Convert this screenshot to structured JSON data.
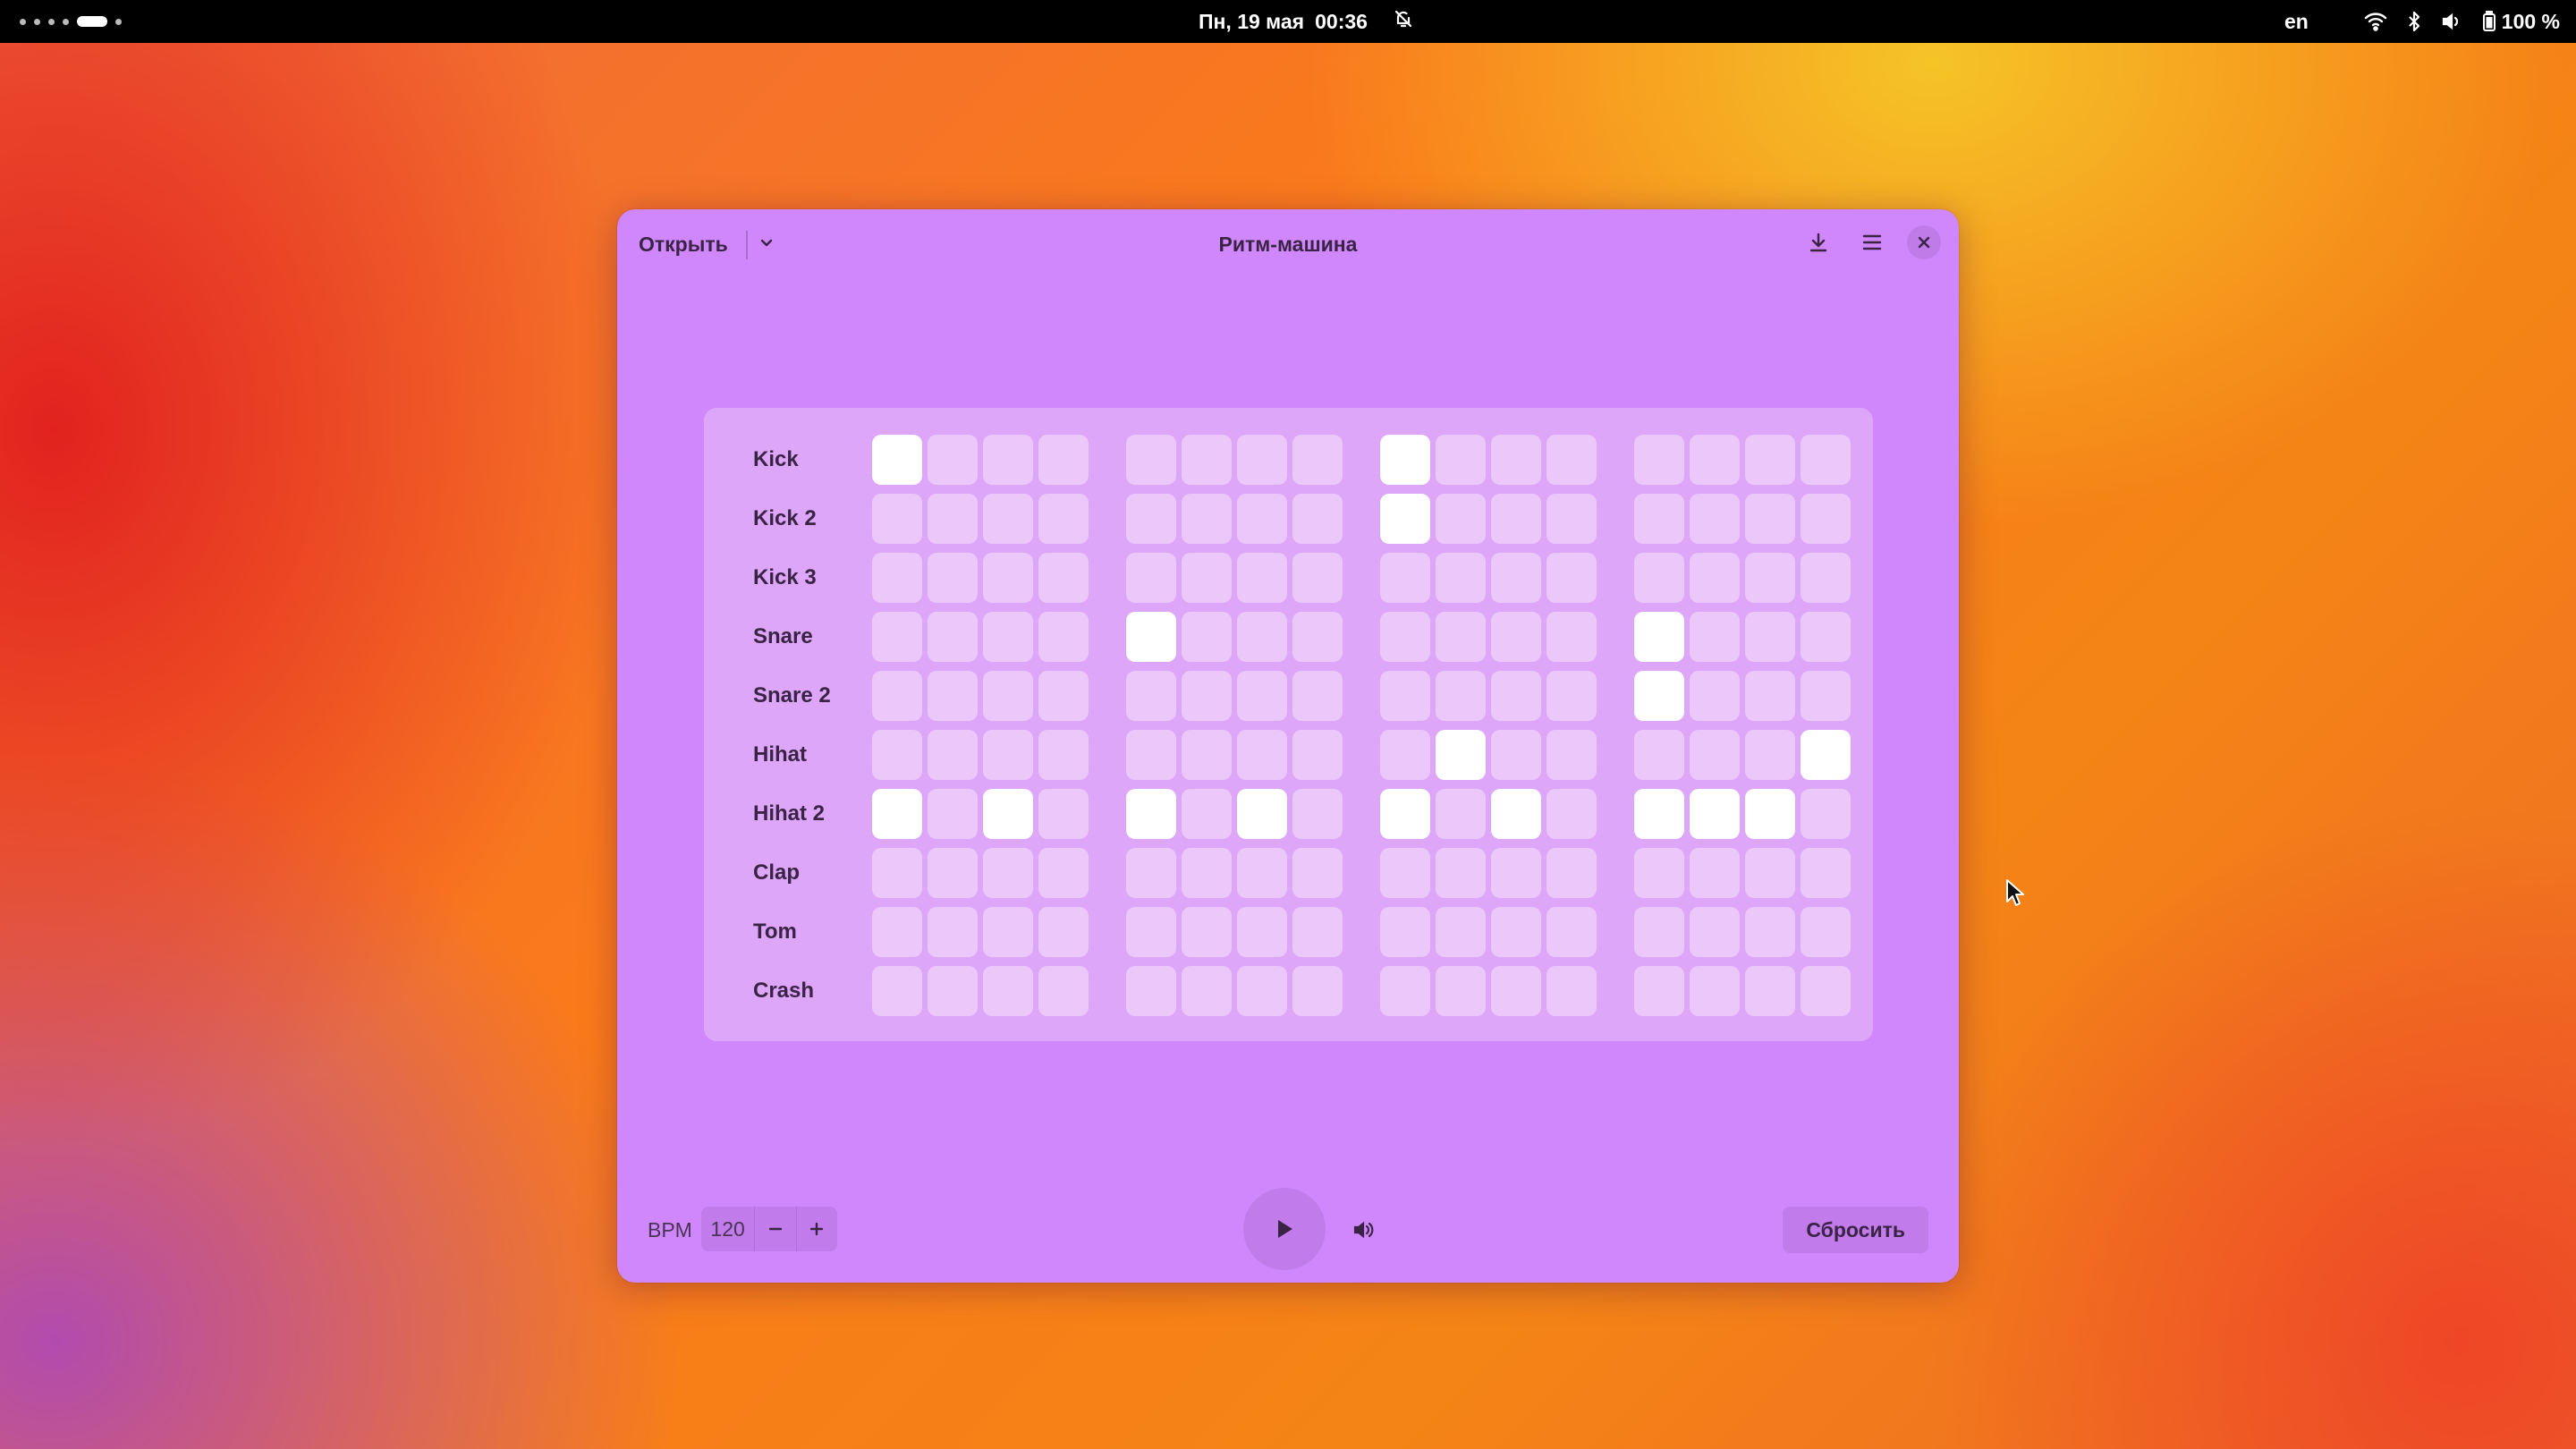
{
  "topbar": {
    "date": "Пн, 19 мая",
    "time": "00:36",
    "language": "en",
    "battery": "100 %",
    "icons": [
      "workspaces-indicator",
      "bell-off-icon",
      "wifi-icon",
      "bluetooth-icon",
      "volume-icon",
      "battery-icon"
    ]
  },
  "window": {
    "title": "Ритм-машина",
    "open_label": "Открыть",
    "header_icons": [
      "chevron-down-icon",
      "download-icon",
      "menu-icon",
      "close-icon"
    ]
  },
  "tracks": [
    {
      "name": "Kick",
      "steps": [
        1,
        0,
        0,
        0,
        0,
        0,
        0,
        0,
        1,
        0,
        0,
        0,
        0,
        0,
        0,
        0
      ]
    },
    {
      "name": "Kick 2",
      "steps": [
        0,
        0,
        0,
        0,
        0,
        0,
        0,
        0,
        1,
        0,
        0,
        0,
        0,
        0,
        0,
        0
      ]
    },
    {
      "name": "Kick 3",
      "steps": [
        0,
        0,
        0,
        0,
        0,
        0,
        0,
        0,
        0,
        0,
        0,
        0,
        0,
        0,
        0,
        0
      ]
    },
    {
      "name": "Snare",
      "steps": [
        0,
        0,
        0,
        0,
        1,
        0,
        0,
        0,
        0,
        0,
        0,
        0,
        1,
        0,
        0,
        0
      ]
    },
    {
      "name": "Snare 2",
      "steps": [
        0,
        0,
        0,
        0,
        0,
        0,
        0,
        0,
        0,
        0,
        0,
        0,
        1,
        0,
        0,
        0
      ]
    },
    {
      "name": "Hihat",
      "steps": [
        0,
        0,
        0,
        0,
        0,
        0,
        0,
        0,
        0,
        1,
        0,
        0,
        0,
        0,
        0,
        1
      ]
    },
    {
      "name": "Hihat 2",
      "steps": [
        1,
        0,
        1,
        0,
        1,
        0,
        1,
        0,
        1,
        0,
        1,
        0,
        1,
        1,
        1,
        0
      ]
    },
    {
      "name": "Clap",
      "steps": [
        0,
        0,
        0,
        0,
        0,
        0,
        0,
        0,
        0,
        0,
        0,
        0,
        0,
        0,
        0,
        0
      ]
    },
    {
      "name": "Tom",
      "steps": [
        0,
        0,
        0,
        0,
        0,
        0,
        0,
        0,
        0,
        0,
        0,
        0,
        0,
        0,
        0,
        0
      ]
    },
    {
      "name": "Crash",
      "steps": [
        0,
        0,
        0,
        0,
        0,
        0,
        0,
        0,
        0,
        0,
        0,
        0,
        0,
        0,
        0,
        0
      ]
    }
  ],
  "footer": {
    "bpm_label": "BPM",
    "bpm_value": "120",
    "decrement": "−",
    "increment": "+",
    "reset_label": "Сбросить",
    "icons": [
      "play-icon",
      "volume-icon"
    ]
  },
  "colors": {
    "window_bg": "#cf87fb",
    "panel_bg": "#dda6f8",
    "step_off": "#ebc8f9",
    "step_on": "#ffffff",
    "text": "#3a2345"
  }
}
